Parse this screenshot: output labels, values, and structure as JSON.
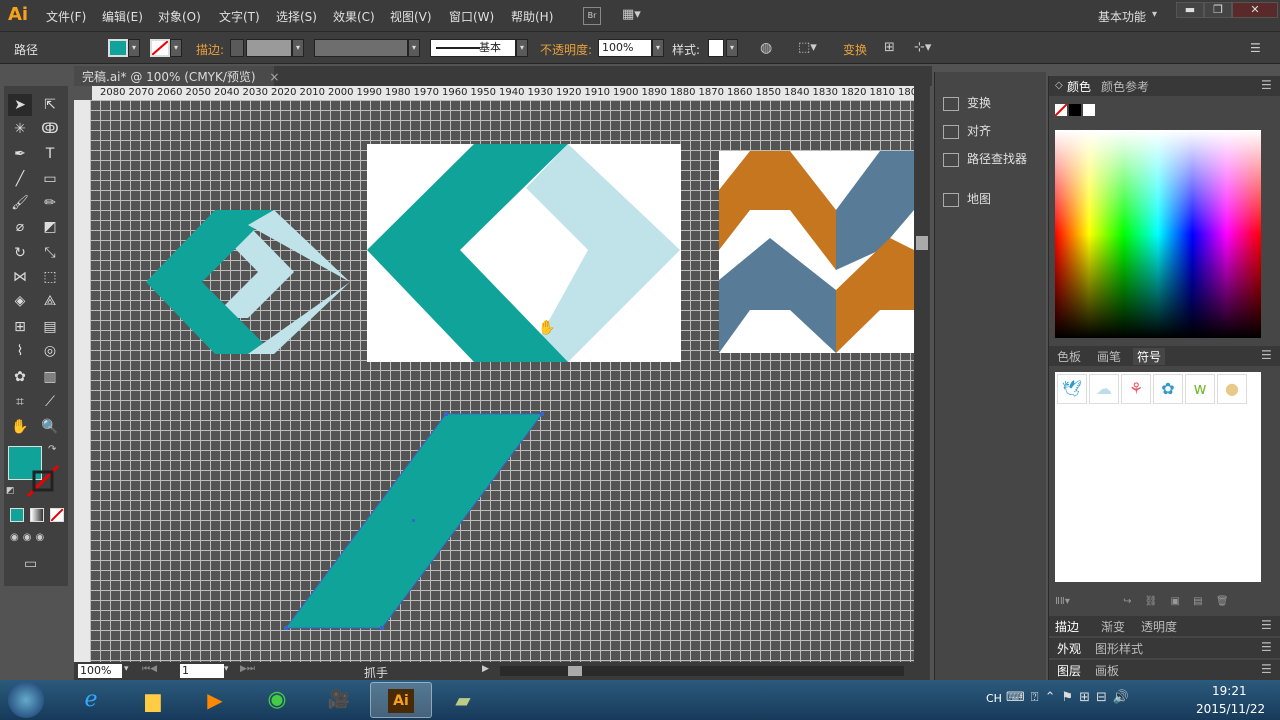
{
  "app": {
    "logo": "Ai"
  },
  "menu": {
    "items": [
      "文件(F)",
      "编辑(E)",
      "对象(O)",
      "文字(T)",
      "选择(S)",
      "效果(C)",
      "视图(V)",
      "窗口(W)",
      "帮助(H)"
    ],
    "bridge": "Br",
    "workspace": "基本功能"
  },
  "control": {
    "object_type": "路径",
    "stroke_label": "描边:",
    "stroke_style": "基本",
    "opacity_label": "不透明度:",
    "opacity_value": "100%",
    "style_label": "样式:",
    "transform_label": "变换",
    "fill_color": "#10a39a"
  },
  "document": {
    "tab_title": "完稿.ai* @ 100% (CMYK/预览)"
  },
  "ruler": {
    "ticks": [
      "2080",
      "2070",
      "2060",
      "2050",
      "2040",
      "2030",
      "2020",
      "2010",
      "2000",
      "1990",
      "1980",
      "1970",
      "1960",
      "1950",
      "1940",
      "1930",
      "1920",
      "1910",
      "1900",
      "1890",
      "1880",
      "1870",
      "1860",
      "1850",
      "1840",
      "1830",
      "1820",
      "1810",
      "180"
    ]
  },
  "panels_mid": {
    "items": [
      "变换",
      "对齐",
      "路径查找器",
      "地图"
    ]
  },
  "panels_right": {
    "color_tabs": [
      "颜色",
      "颜色参考"
    ],
    "symbol_tabs": [
      "色板",
      "画笔",
      "符号"
    ],
    "stroke_tabs": [
      "描边",
      "渐变",
      "透明度"
    ],
    "appearance_tabs": [
      "外观",
      "图形样式"
    ],
    "layer_tabs": [
      "图层",
      "画板"
    ]
  },
  "status": {
    "zoom": "100%",
    "page": "1",
    "tool": "抓手"
  },
  "taskbar": {
    "lang": "CH",
    "time": "19:21",
    "date": "2015/11/22"
  },
  "colors": {
    "teal": "#10a39a",
    "light_teal": "#bfe3e8",
    "orange": "#c6761f",
    "steel_blue": "#587c98"
  }
}
